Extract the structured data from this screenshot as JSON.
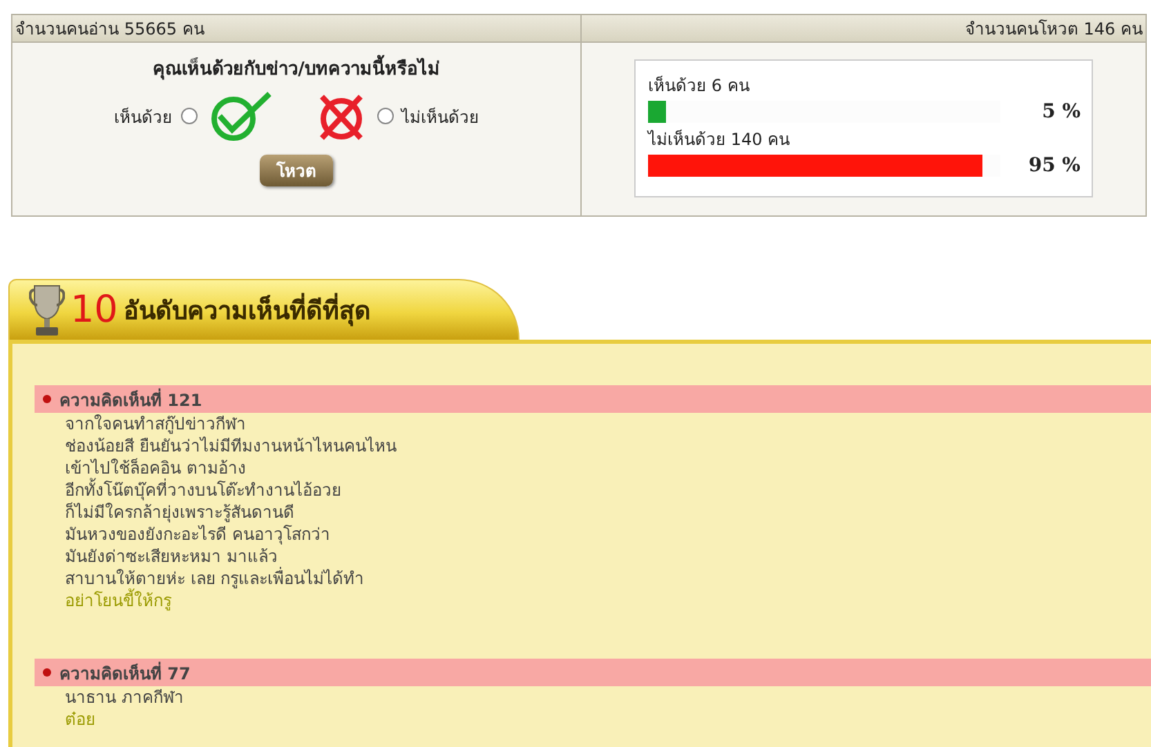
{
  "stats": {
    "readers": "จำนวนคนอ่าน 55665 คน",
    "voters": "จำนวนคนโหวต 146 คน"
  },
  "poll": {
    "question": "คุณเห็นด้วยกับข่าว/บทความนี้หรือไม่",
    "options": [
      {
        "label": "เห็นด้วย",
        "kind": "agree",
        "selected": false
      },
      {
        "label": "ไม่เห็นด้วย",
        "kind": "disagree",
        "selected": false
      }
    ],
    "button": "โหวต"
  },
  "results": [
    {
      "label": "เห็นด้วย 6 คน",
      "level": 0.05,
      "percent": "5 %",
      "color": "#1aa832"
    },
    {
      "label": "ไม่เห็นด้วย 140 คน",
      "level": 0.95,
      "percent": "95 %",
      "color": "#ff140a"
    }
  ],
  "top_comments": {
    "rank": "10",
    "title": "อันดับความเห็นที่ดีที่สุด",
    "comments": [
      {
        "heading": "ความคิดเห็นที่ 121",
        "lines": [
          "จากใจคนทำสกู๊ปข่าวกีฬา",
          "ช่องน้อยสี ยืนยันว่าไม่มีทีมงานหน้าไหนคนไหน",
          "เข้าไปใช้ล็อคอิน ตามอ้าง",
          "อีกทั้งโน๊ตบุ๊คที่วางบนโต๊ะทำงานไอ้อวย",
          "ก็ไม่มีใครกล้ายุ่งเพราะรู้สันดานดี",
          "มันหวงของยังกะอะไรดี คนอาวุโสกว่า",
          "มันยังด่าซะเสียหะหมา มาแล้ว",
          "สาบานให้ตายห่ะ เลย กรูและเพื่อนไม่ได้ทำ"
        ],
        "author": "อย่าโยนขี้ให้กรู"
      },
      {
        "heading": "ความคิดเห็นที่ 77",
        "lines": [
          "นาธาน ภาคกีฬา"
        ],
        "author": "ต๋อย"
      }
    ]
  }
}
